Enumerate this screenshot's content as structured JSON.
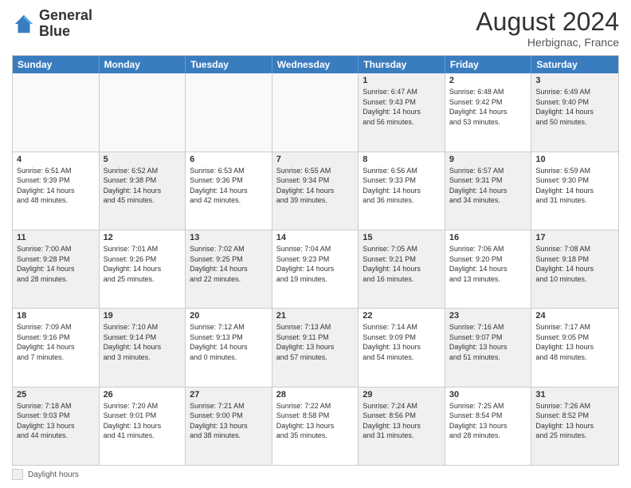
{
  "header": {
    "logo_line1": "General",
    "logo_line2": "Blue",
    "month_year": "August 2024",
    "location": "Herbignac, France"
  },
  "days_of_week": [
    "Sunday",
    "Monday",
    "Tuesday",
    "Wednesday",
    "Thursday",
    "Friday",
    "Saturday"
  ],
  "weeks": [
    [
      {
        "day": "",
        "text": "",
        "empty": true
      },
      {
        "day": "",
        "text": "",
        "empty": true
      },
      {
        "day": "",
        "text": "",
        "empty": true
      },
      {
        "day": "",
        "text": "",
        "empty": true
      },
      {
        "day": "1",
        "text": "Sunrise: 6:47 AM\nSunset: 9:43 PM\nDaylight: 14 hours\nand 56 minutes.",
        "shaded": true
      },
      {
        "day": "2",
        "text": "Sunrise: 6:48 AM\nSunset: 9:42 PM\nDaylight: 14 hours\nand 53 minutes.",
        "shaded": false
      },
      {
        "day": "3",
        "text": "Sunrise: 6:49 AM\nSunset: 9:40 PM\nDaylight: 14 hours\nand 50 minutes.",
        "shaded": true
      }
    ],
    [
      {
        "day": "4",
        "text": "Sunrise: 6:51 AM\nSunset: 9:39 PM\nDaylight: 14 hours\nand 48 minutes.",
        "shaded": false
      },
      {
        "day": "5",
        "text": "Sunrise: 6:52 AM\nSunset: 9:38 PM\nDaylight: 14 hours\nand 45 minutes.",
        "shaded": true
      },
      {
        "day": "6",
        "text": "Sunrise: 6:53 AM\nSunset: 9:36 PM\nDaylight: 14 hours\nand 42 minutes.",
        "shaded": false
      },
      {
        "day": "7",
        "text": "Sunrise: 6:55 AM\nSunset: 9:34 PM\nDaylight: 14 hours\nand 39 minutes.",
        "shaded": true
      },
      {
        "day": "8",
        "text": "Sunrise: 6:56 AM\nSunset: 9:33 PM\nDaylight: 14 hours\nand 36 minutes.",
        "shaded": false
      },
      {
        "day": "9",
        "text": "Sunrise: 6:57 AM\nSunset: 9:31 PM\nDaylight: 14 hours\nand 34 minutes.",
        "shaded": true
      },
      {
        "day": "10",
        "text": "Sunrise: 6:59 AM\nSunset: 9:30 PM\nDaylight: 14 hours\nand 31 minutes.",
        "shaded": false
      }
    ],
    [
      {
        "day": "11",
        "text": "Sunrise: 7:00 AM\nSunset: 9:28 PM\nDaylight: 14 hours\nand 28 minutes.",
        "shaded": true
      },
      {
        "day": "12",
        "text": "Sunrise: 7:01 AM\nSunset: 9:26 PM\nDaylight: 14 hours\nand 25 minutes.",
        "shaded": false
      },
      {
        "day": "13",
        "text": "Sunrise: 7:02 AM\nSunset: 9:25 PM\nDaylight: 14 hours\nand 22 minutes.",
        "shaded": true
      },
      {
        "day": "14",
        "text": "Sunrise: 7:04 AM\nSunset: 9:23 PM\nDaylight: 14 hours\nand 19 minutes.",
        "shaded": false
      },
      {
        "day": "15",
        "text": "Sunrise: 7:05 AM\nSunset: 9:21 PM\nDaylight: 14 hours\nand 16 minutes.",
        "shaded": true
      },
      {
        "day": "16",
        "text": "Sunrise: 7:06 AM\nSunset: 9:20 PM\nDaylight: 14 hours\nand 13 minutes.",
        "shaded": false
      },
      {
        "day": "17",
        "text": "Sunrise: 7:08 AM\nSunset: 9:18 PM\nDaylight: 14 hours\nand 10 minutes.",
        "shaded": true
      }
    ],
    [
      {
        "day": "18",
        "text": "Sunrise: 7:09 AM\nSunset: 9:16 PM\nDaylight: 14 hours\nand 7 minutes.",
        "shaded": false
      },
      {
        "day": "19",
        "text": "Sunrise: 7:10 AM\nSunset: 9:14 PM\nDaylight: 14 hours\nand 3 minutes.",
        "shaded": true
      },
      {
        "day": "20",
        "text": "Sunrise: 7:12 AM\nSunset: 9:13 PM\nDaylight: 14 hours\nand 0 minutes.",
        "shaded": false
      },
      {
        "day": "21",
        "text": "Sunrise: 7:13 AM\nSunset: 9:11 PM\nDaylight: 13 hours\nand 57 minutes.",
        "shaded": true
      },
      {
        "day": "22",
        "text": "Sunrise: 7:14 AM\nSunset: 9:09 PM\nDaylight: 13 hours\nand 54 minutes.",
        "shaded": false
      },
      {
        "day": "23",
        "text": "Sunrise: 7:16 AM\nSunset: 9:07 PM\nDaylight: 13 hours\nand 51 minutes.",
        "shaded": true
      },
      {
        "day": "24",
        "text": "Sunrise: 7:17 AM\nSunset: 9:05 PM\nDaylight: 13 hours\nand 48 minutes.",
        "shaded": false
      }
    ],
    [
      {
        "day": "25",
        "text": "Sunrise: 7:18 AM\nSunset: 9:03 PM\nDaylight: 13 hours\nand 44 minutes.",
        "shaded": true
      },
      {
        "day": "26",
        "text": "Sunrise: 7:20 AM\nSunset: 9:01 PM\nDaylight: 13 hours\nand 41 minutes.",
        "shaded": false
      },
      {
        "day": "27",
        "text": "Sunrise: 7:21 AM\nSunset: 9:00 PM\nDaylight: 13 hours\nand 38 minutes.",
        "shaded": true
      },
      {
        "day": "28",
        "text": "Sunrise: 7:22 AM\nSunset: 8:58 PM\nDaylight: 13 hours\nand 35 minutes.",
        "shaded": false
      },
      {
        "day": "29",
        "text": "Sunrise: 7:24 AM\nSunset: 8:56 PM\nDaylight: 13 hours\nand 31 minutes.",
        "shaded": true
      },
      {
        "day": "30",
        "text": "Sunrise: 7:25 AM\nSunset: 8:54 PM\nDaylight: 13 hours\nand 28 minutes.",
        "shaded": false
      },
      {
        "day": "31",
        "text": "Sunrise: 7:26 AM\nSunset: 8:52 PM\nDaylight: 13 hours\nand 25 minutes.",
        "shaded": true
      }
    ]
  ],
  "legend": {
    "label": "Daylight hours"
  }
}
